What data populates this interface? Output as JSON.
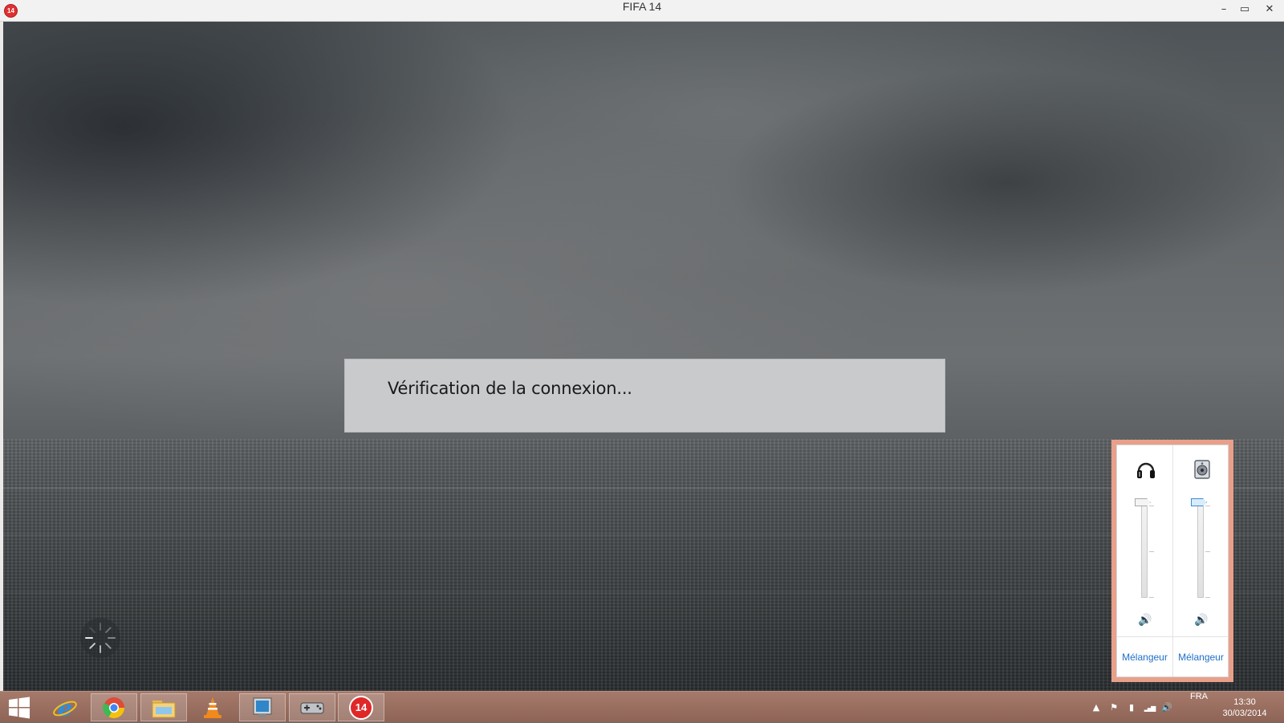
{
  "window": {
    "title": "FIFA 14",
    "app_badge": "14",
    "minimize_glyph": "–",
    "maximize_glyph": "▭",
    "close_glyph": "✕"
  },
  "game": {
    "message": "Vérification de la connexion..."
  },
  "volume_mixer": {
    "devices": [
      {
        "icon": "headphones-icon",
        "level": 1.0,
        "active": false,
        "mixer_label": "Mélangeur"
      },
      {
        "icon": "speaker-device-icon",
        "level": 1.0,
        "active": true,
        "mixer_label": "Mélangeur"
      }
    ],
    "speaker_glyph": "🔊"
  },
  "taskbar": {
    "pinned": [
      {
        "name": "internet-explorer-icon",
        "active": false
      },
      {
        "name": "chrome-icon",
        "active": true
      },
      {
        "name": "file-explorer-icon",
        "active": true
      },
      {
        "name": "vlc-icon",
        "active": false
      },
      {
        "name": "computer-icon",
        "active": true
      },
      {
        "name": "gamepad-icon",
        "active": true
      },
      {
        "name": "fifa-icon",
        "active": true
      }
    ],
    "fifa_badge": "14",
    "tray": {
      "show_hidden_glyph": "▲",
      "flag_glyph": "⚑",
      "battery_glyph": "▮",
      "signal_glyph": "▂▄▆",
      "volume_glyph": "🔊"
    },
    "language": "FRA",
    "time": "13:30",
    "date": "30/03/2014"
  },
  "colors": {
    "taskbar": "#9a6f61",
    "flyout_border": "#e8a08a",
    "link": "#1e6fc8",
    "message_box": "#c8cacc"
  }
}
